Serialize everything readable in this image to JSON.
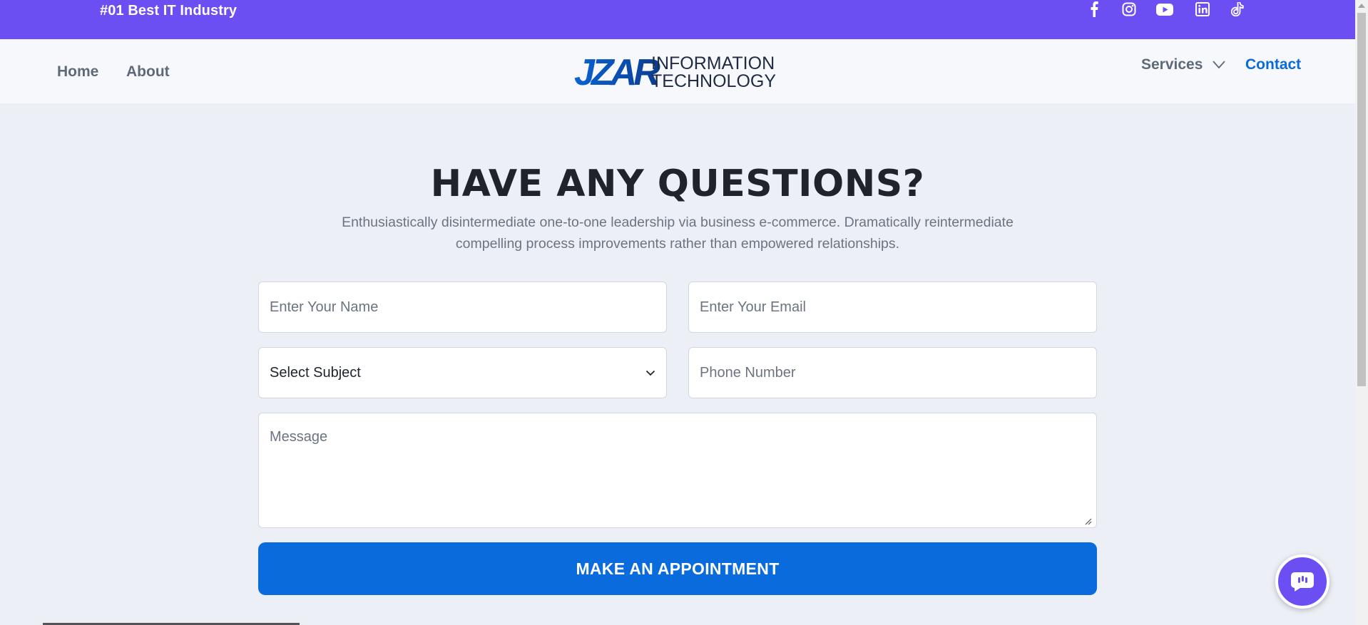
{
  "topbar": {
    "tagline": "#01 Best IT Industry",
    "social": [
      "facebook-icon",
      "instagram-icon",
      "youtube-icon",
      "linkedin-icon",
      "tiktok-icon"
    ],
    "color": "#6c4ff3"
  },
  "nav": {
    "home": "Home",
    "about": "About",
    "services": "Services",
    "contact": "Contact",
    "active_color": "#0a6ad8"
  },
  "logo": {
    "mark": "JZAR",
    "line1": "INFORMATION",
    "line2": "TECHNOLOGY"
  },
  "section": {
    "title": "HAVE ANY QUESTIONS?",
    "subtitle_line1": "Enthusiastically disintermediate one-to-one leadership via business e-commerce. Dramatically reintermediate",
    "subtitle_line2": "compelling process improvements rather than empowered relationships."
  },
  "form": {
    "name_placeholder": "Enter Your Name",
    "email_placeholder": "Enter Your Email",
    "subject_value": "Select Subject",
    "phone_placeholder": "Phone Number",
    "message_placeholder": "Message",
    "submit_label": "MAKE AN APPOINTMENT",
    "button_color": "#0a6bdc"
  },
  "chat": {
    "icon": "chat-bubble-icon"
  }
}
